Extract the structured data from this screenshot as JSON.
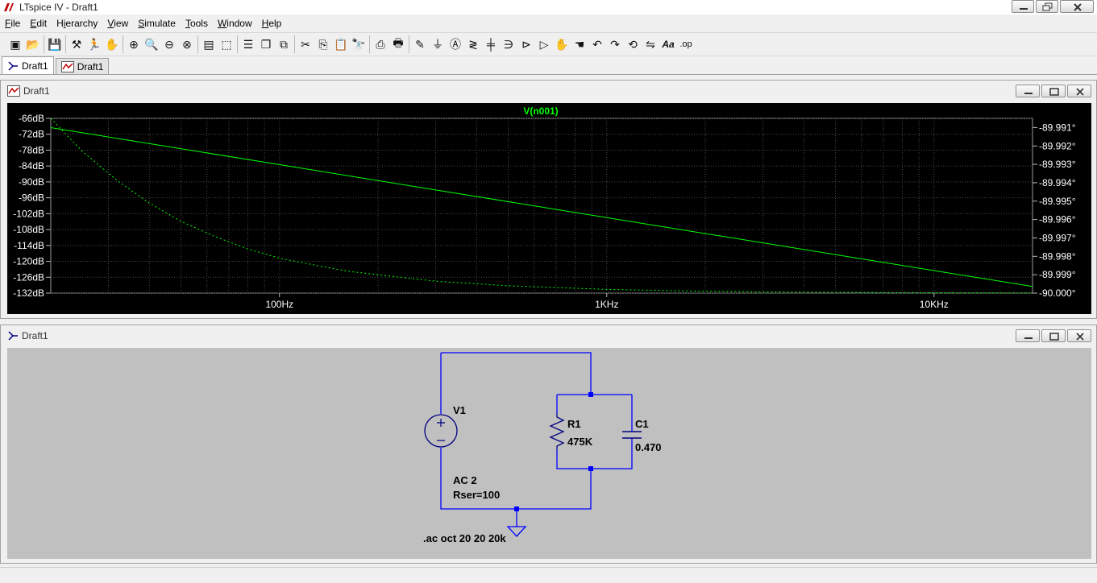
{
  "window": {
    "title": "LTspice IV - Draft1"
  },
  "menu": [
    "File",
    "Edit",
    "Hierarchy",
    "View",
    "Simulate",
    "Tools",
    "Window",
    "Help"
  ],
  "menu_underline": [
    "F",
    "E",
    "i",
    "V",
    "S",
    "T",
    "W",
    "H"
  ],
  "toolbar": {
    "groups": [
      [
        "new-schematic-icon",
        "open-icon"
      ],
      [
        "save-icon"
      ],
      [
        "control-panel-icon",
        "run-icon",
        "halt-icon"
      ],
      [
        "zoom-in-icon",
        "pan-icon",
        "zoom-out-icon",
        "zoom-cancel-icon"
      ],
      [
        "autorange-icon",
        "zoom-fit-icon"
      ],
      [
        "tile-horizontal-icon",
        "cascade-icon",
        "close-window-icon"
      ],
      [
        "cut-icon",
        "copy-icon",
        "paste-icon",
        "find-icon"
      ],
      [
        "print-setup-icon",
        "print-icon"
      ],
      [
        "wire-icon",
        "ground-icon",
        "label-icon",
        "resistor-icon",
        "capacitor-icon",
        "inductor-icon",
        "diode-icon",
        "component-icon",
        "move-icon",
        "drag-icon",
        "undo-icon",
        "redo-icon",
        "rotate-icon",
        "mirror-icon",
        "text-icon",
        "spice-directive-icon"
      ]
    ],
    "text_icon_label": "Aa",
    "spice_label": ".op"
  },
  "tabs": [
    {
      "label": "Draft1",
      "icon": "schematic-icon",
      "active": true
    },
    {
      "label": "Draft1",
      "icon": "waveform-icon",
      "active": false
    }
  ],
  "waveform_window": {
    "title": "Draft1",
    "trace_name": "V(n001)",
    "trace_color": "#00ff00"
  },
  "schematic_window": {
    "title": "Draft1"
  },
  "chart_data": {
    "type": "line",
    "title": "V(n001)",
    "x_scale": "log",
    "x_range": [
      20,
      20000
    ],
    "x_ticks": [
      {
        "value": 100,
        "label": "100Hz"
      },
      {
        "value": 1000,
        "label": "1KHz"
      },
      {
        "value": 10000,
        "label": "10KHz"
      }
    ],
    "y_left_range": [
      -132,
      -66
    ],
    "y_left_ticks": [
      "-66dB",
      "-72dB",
      "-78dB",
      "-84dB",
      "-90dB",
      "-96dB",
      "-102dB",
      "-108dB",
      "-114dB",
      "-120dB",
      "-126dB",
      "-132dB"
    ],
    "y_left_values": [
      -66,
      -72,
      -78,
      -84,
      -90,
      -96,
      -102,
      -108,
      -114,
      -120,
      -126,
      -132
    ],
    "y_right_range": [
      -90.0,
      -89.9905
    ],
    "y_right_ticks": [
      "-89.991°",
      "-89.992°",
      "-89.993°",
      "-89.994°",
      "-89.995°",
      "-89.996°",
      "-89.997°",
      "-89.998°",
      "-89.999°",
      "-90.000°"
    ],
    "y_right_values": [
      -89.991,
      -89.992,
      -89.993,
      -89.994,
      -89.995,
      -89.996,
      -89.997,
      -89.998,
      -89.999,
      -90.0
    ],
    "grid": true,
    "series": [
      {
        "name": "V(n001)",
        "kind": "magnitude",
        "style": "solid",
        "axis": "left",
        "x": [
          20,
          20000
        ],
        "y": [
          -69.5,
          -129.5
        ]
      },
      {
        "kind": "phase",
        "style": "dotted",
        "axis": "right",
        "x": [
          20,
          25,
          32,
          40,
          50,
          63,
          80,
          100,
          130,
          160,
          200,
          300,
          500,
          1000,
          2000,
          5000,
          10000,
          20000
        ],
        "y": [
          -89.9905,
          -89.9923,
          -89.9939,
          -89.9951,
          -89.9961,
          -89.9969,
          -89.9976,
          -89.9981,
          -89.9985,
          -89.9988,
          -89.999,
          -89.99935,
          -89.9996,
          -89.9998,
          -89.9999,
          -89.99996,
          -89.99998,
          -89.99999
        ]
      }
    ]
  },
  "schematic": {
    "v1": {
      "name": "V1",
      "value": "AC 2",
      "extra": "Rser=100"
    },
    "r1": {
      "name": "R1",
      "value": "475K"
    },
    "c1": {
      "name": "C1",
      "value": "0.470"
    },
    "directive": ".ac oct 20 20 20k",
    "wire_color": "#0000ff",
    "component_color": "#000080"
  }
}
